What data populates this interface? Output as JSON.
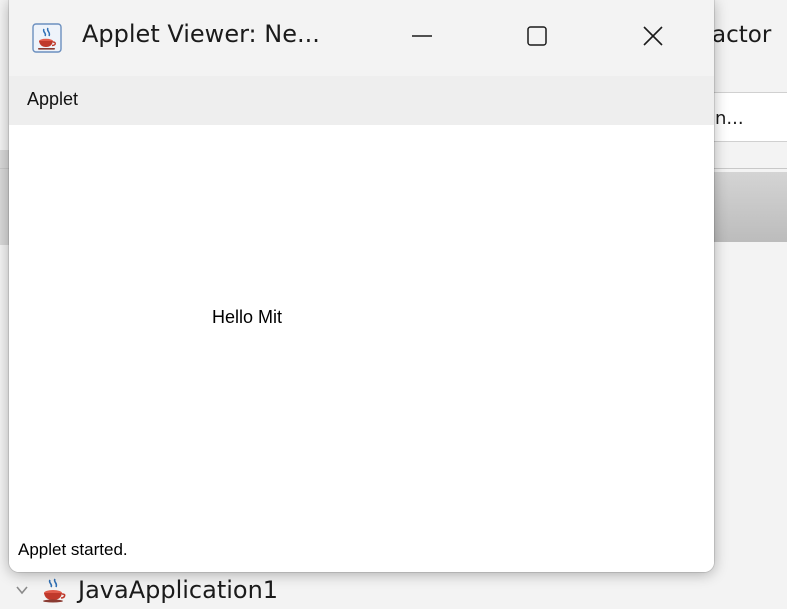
{
  "background_ide": {
    "toolbar_label_fragment": "actor",
    "combo_fragment": "on...",
    "tree_item": {
      "label": "JavaApplication1",
      "icon": "java-coffee-cup-icon",
      "expander": "chevron-down-icon"
    }
  },
  "applet_window": {
    "title": "Applet Viewer: Ne...",
    "app_icon": "java-coffee-cup-icon",
    "controls": {
      "minimize": "minimize-icon",
      "maximize": "maximize-icon",
      "close": "close-icon"
    },
    "menu": {
      "items": [
        "Applet"
      ]
    },
    "content": {
      "message": "Hello Mit"
    },
    "status": "Applet started."
  },
  "colors": {
    "titlebar_bg": "#f3f3f3",
    "menubar_bg": "#eeeeee",
    "content_bg": "#ffffff",
    "java_cup_red": "#c0392b",
    "java_cup_steam": "#2e6fb5"
  }
}
